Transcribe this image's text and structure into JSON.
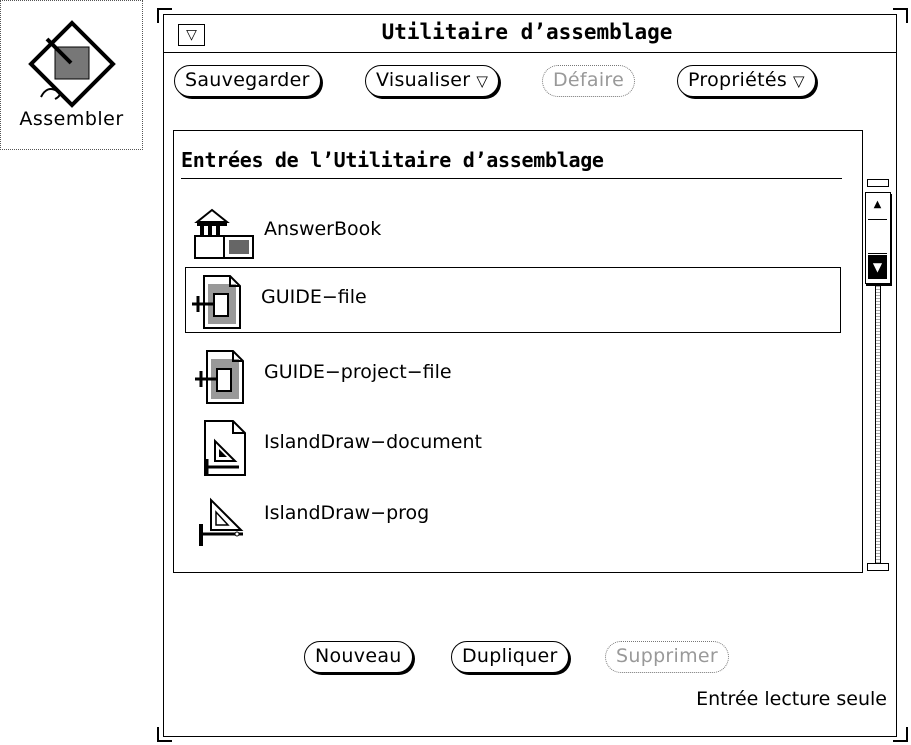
{
  "desktop_icon": {
    "label": "Assembler"
  },
  "window": {
    "title": "Utilitaire d’assemblage",
    "menu_button_glyph": "▽",
    "toolbar": {
      "save_label": "Sauvegarder",
      "view_label": "Visualiser",
      "undo_label": "Défaire",
      "properties_label": "Propriétés",
      "menu_caret": "▽"
    },
    "list": {
      "title": "Entrées de l’Utilitaire d’assemblage",
      "items": [
        {
          "label": "AnswerBook",
          "icon": "answerbook-icon",
          "selected": false
        },
        {
          "label": "GUIDE−file",
          "icon": "guide-file-icon",
          "selected": true
        },
        {
          "label": "GUIDE−project−file",
          "icon": "guide-project-file-icon",
          "selected": false
        },
        {
          "label": "IslandDraw−document",
          "icon": "islanddraw-document-icon",
          "selected": false
        },
        {
          "label": "IslandDraw−prog",
          "icon": "islanddraw-prog-icon",
          "selected": false
        }
      ]
    },
    "actions": {
      "new_label": "Nouveau",
      "duplicate_label": "Dupliquer",
      "delete_label": "Supprimer"
    },
    "footer_status": "Entrée lecture seule"
  }
}
